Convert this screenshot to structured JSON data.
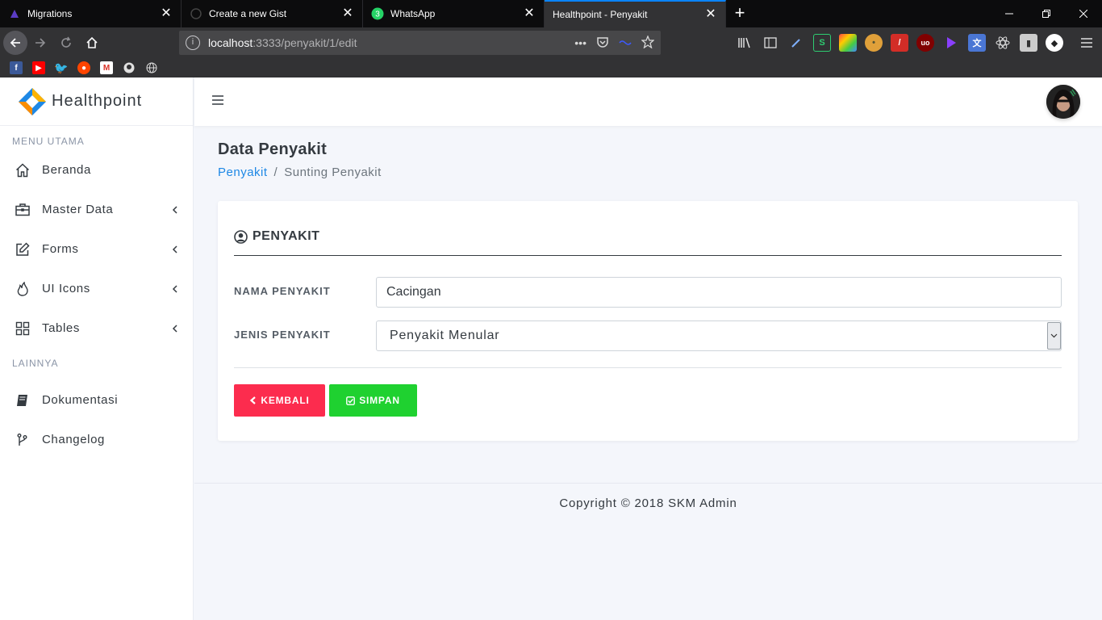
{
  "browser": {
    "tabs": [
      {
        "title": "Migrations"
      },
      {
        "title": "Create a new Gist"
      },
      {
        "title": "WhatsApp",
        "badge": "3"
      },
      {
        "title": "Healthpoint - Penyakit"
      }
    ],
    "url_host": "localhost",
    "url_rest": ":3333/penyakit/1/edit"
  },
  "app": {
    "brand": "Healthpoint",
    "menu_main_heading": "MENU UTAMA",
    "menu_main": [
      {
        "label": "Beranda",
        "icon": "home-icon"
      },
      {
        "label": "Master Data",
        "icon": "briefcase-icon"
      },
      {
        "label": "Forms",
        "icon": "edit-icon"
      },
      {
        "label": "UI Icons",
        "icon": "fire-icon"
      },
      {
        "label": "Tables",
        "icon": "grid-icon"
      }
    ],
    "menu_other_heading": "LAINNYA",
    "menu_other": [
      {
        "label": "Dokumentasi",
        "icon": "book-icon"
      },
      {
        "label": "Changelog",
        "icon": "branch-icon"
      }
    ]
  },
  "page": {
    "title": "Data Penyakit",
    "breadcrumb_link": "Penyakit",
    "breadcrumb_sep": "/",
    "breadcrumb_current": "Sunting Penyakit"
  },
  "form": {
    "card_title": "PENYAKIT",
    "nama_label": "NAMA PENYAKIT",
    "nama_value": "Cacingan",
    "jenis_label": "JENIS PENYAKIT",
    "jenis_value": "Penyakit Menular",
    "back_label": "KEMBALI",
    "save_label": "SIMPAN"
  },
  "footer": {
    "copyright": "Copyright © 2018 SKM Admin"
  },
  "colors": {
    "primary": "#1e88e5",
    "danger": "#fc2c4e",
    "success": "#1fd130"
  }
}
